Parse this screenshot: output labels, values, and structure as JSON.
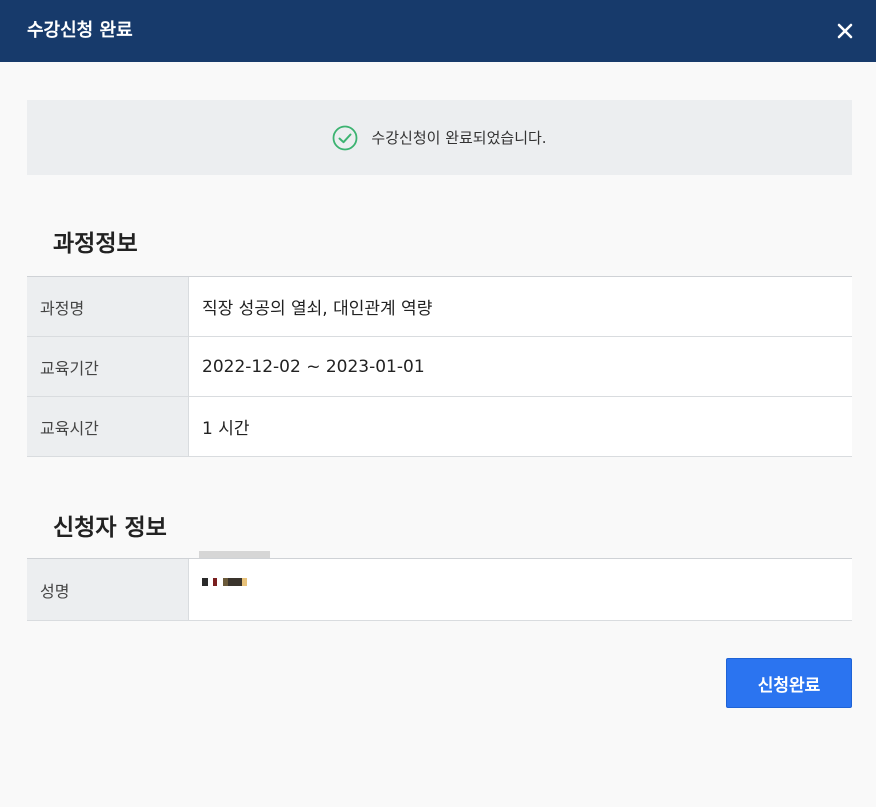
{
  "modal": {
    "title": "수강신청 완료"
  },
  "notice": {
    "icon": "check-circle-icon",
    "message": "수강신청이 완료되었습니다."
  },
  "course_info": {
    "heading": "과정정보",
    "rows": [
      {
        "label": "과정명",
        "value": "직장 성공의 열쇠, 대인관계 역량"
      },
      {
        "label": "교육기간",
        "value": "2022-12-02 ~ 2023-01-01"
      },
      {
        "label": "교육시간",
        "value": "1 시간"
      }
    ]
  },
  "applicant_info": {
    "heading": "신청자 정보",
    "rows": [
      {
        "label": "성명",
        "value": ""
      }
    ]
  },
  "actions": {
    "submit_label": "신청완료"
  },
  "colors": {
    "header_bg": "#173a6b",
    "primary_button": "#2b74f0",
    "success_icon": "#3cb371"
  }
}
